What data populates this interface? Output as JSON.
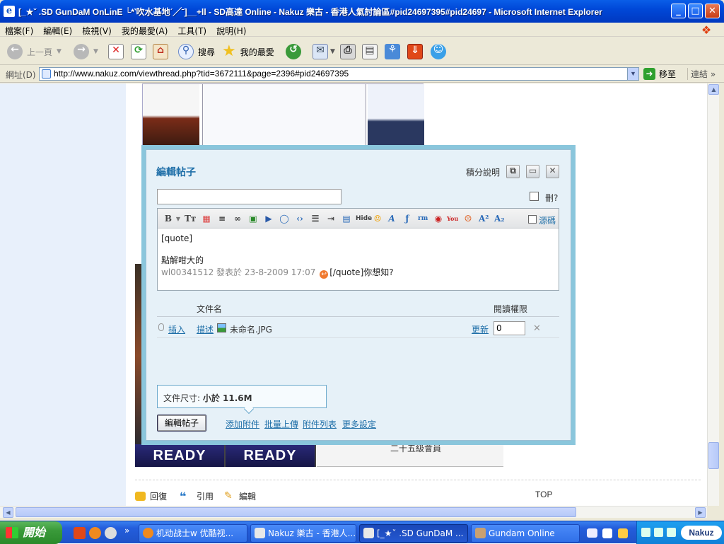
{
  "window": {
    "title": "[_★ˇ .SD GunDaM OnLinE └*‵吹水基地ˊ╱ˉ]__+ll - SD高達 Online - Nakuz 樂古 - 香港人氣討論區#pid24697395#pid24697 - Microsoft Internet Explorer",
    "title_icon": "ie-page-icon"
  },
  "menu": [
    "檔案(F)",
    "編輯(E)",
    "檢視(V)",
    "我的最愛(A)",
    "工具(T)",
    "說明(H)"
  ],
  "toolbar": {
    "back_label": "上一頁",
    "search_label": "搜尋",
    "favorites_label": "我的最愛"
  },
  "address": {
    "label": "網址(D)",
    "url": "http://www.nakuz.com/viewthread.php?tid=3672111&page=2396#pid24697395",
    "go_label": "移至",
    "links_label": "連結"
  },
  "page": {
    "banner_left": "READY",
    "banner_right": "READY",
    "rank_text": "二十五級會員",
    "actions": {
      "reply": "回復",
      "quote": "引用",
      "edit": "編輯"
    },
    "top_link": "TOP"
  },
  "modal": {
    "title": "編輯帖子",
    "help_link": "積分說明",
    "subject_value": "",
    "delete_label": "刪?",
    "source_label": "源碼",
    "editor": {
      "line1": "[quote]",
      "line2": "點解咁大的",
      "quote_author": "wl00341512 發表於 23-8-2009 17:07",
      "line3_tail": "[/quote]你想知?"
    },
    "attachments": {
      "col_name": "文件名",
      "col_perm": "閱讀權限",
      "insert": "插入",
      "describe": "描述",
      "filename": "未命名.JPG",
      "update": "更新",
      "perm_value": "0"
    },
    "size_label": "文件尺寸:",
    "size_value": "小於 11.6M",
    "submit_label": "編輯帖子",
    "footer_links": [
      "添加附件",
      "批量上傳",
      "附件列表",
      "更多設定"
    ]
  },
  "taskbar": {
    "start_label": "開始",
    "tasks": [
      "机动战士w 优酷视...",
      "Nakuz 樂古 - 香港人...",
      "[_★ˇ .SD GunDaM ...",
      "Gundam Online"
    ],
    "tray_logo": "Nakuz"
  }
}
